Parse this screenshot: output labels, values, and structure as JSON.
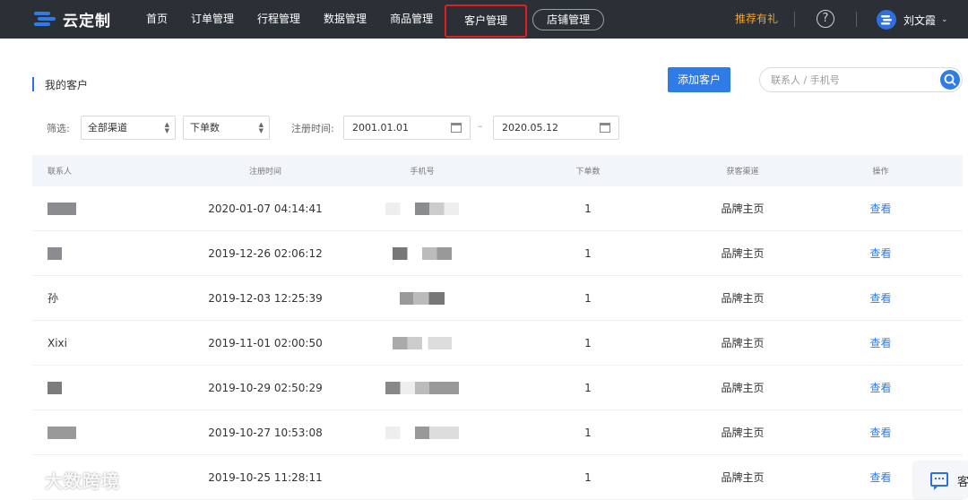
{
  "topbar": {
    "logo_text": "云定制",
    "nav": [
      {
        "label": "首页"
      },
      {
        "label": "订单管理"
      },
      {
        "label": "行程管理"
      },
      {
        "label": "数据管理"
      },
      {
        "label": "商品管理"
      },
      {
        "label": "客户管理"
      },
      {
        "label": "店铺管理"
      }
    ],
    "active_nav": "客户管理",
    "recommend": "推荐有礼",
    "help_glyph": "?",
    "user_name": "刘文霞",
    "user_chevron": "⌄"
  },
  "page": {
    "title": "我的客户",
    "add_button": "添加客户",
    "search_placeholder": "联系人 / 手机号"
  },
  "filters": {
    "label": "筛选:",
    "channel_select": "全部渠道",
    "order_select": "下单数",
    "register_label": "注册时间:",
    "date_from": "2001.01.01",
    "date_to": "2020.05.12",
    "dash": "–"
  },
  "table": {
    "headers": {
      "name": "联系人",
      "time": "注册时间",
      "phone": "手机号",
      "count": "下单数",
      "channel": "获客渠道",
      "op": "操作"
    },
    "rows": [
      {
        "name": "",
        "time": "2020-01-07 04:14:41",
        "count": "1",
        "channel": "品牌主页",
        "op": "查看"
      },
      {
        "name": "",
        "time": "2019-12-26 02:06:12",
        "count": "1",
        "channel": "品牌主页",
        "op": "查看"
      },
      {
        "name": "孙",
        "time": "2019-12-03 12:25:39",
        "count": "1",
        "channel": "品牌主页",
        "op": "查看"
      },
      {
        "name": "Xixi",
        "time": "2019-11-01 02:00:50",
        "count": "1",
        "channel": "品牌主页",
        "op": "查看"
      },
      {
        "name": "",
        "time": "2019-10-29 02:50:29",
        "count": "1",
        "channel": "品牌主页",
        "op": "查看"
      },
      {
        "name": "",
        "time": "2019-10-27 10:53:08",
        "count": "1",
        "channel": "品牌主页",
        "op": "查看"
      },
      {
        "name": "",
        "time": "2019-10-25 11:28:11",
        "count": "1",
        "channel": "品牌主页",
        "op": "查看"
      }
    ]
  },
  "watermark": "大数跨境",
  "chat_widget": "客",
  "colors": {
    "topbar_bg": "#2b2f36",
    "accent": "#2f7be8",
    "highlight": "#e02020",
    "recommend": "#f5a623"
  }
}
